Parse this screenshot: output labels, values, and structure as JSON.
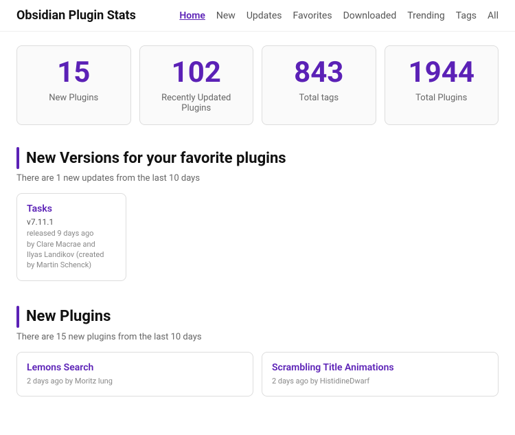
{
  "header": {
    "site_title": "Obsidian Plugin Stats",
    "nav": [
      {
        "label": "Home",
        "active": true
      },
      {
        "label": "New",
        "active": false
      },
      {
        "label": "Updates",
        "active": false
      },
      {
        "label": "Favorites",
        "active": false
      },
      {
        "label": "Downloaded",
        "active": false
      },
      {
        "label": "Trending",
        "active": false
      },
      {
        "label": "Tags",
        "active": false
      },
      {
        "label": "All",
        "active": false
      }
    ]
  },
  "stats": [
    {
      "number": "15",
      "label": "New Plugins"
    },
    {
      "number": "102",
      "label": "Recently Updated Plugins"
    },
    {
      "number": "843",
      "label": "Total tags"
    },
    {
      "number": "1944",
      "label": "Total Plugins"
    }
  ],
  "updates_section": {
    "title": "New Versions for your favorite plugins",
    "subtitle": "There are 1 new updates from the last 10 days",
    "plugins": [
      {
        "name": "Tasks",
        "version": "v7.11.1",
        "meta": "released 9 days ago\nby Clare Macrae and\nIlyas Landikov (created\nby Martin Schenck)"
      }
    ]
  },
  "new_plugins_section": {
    "title": "New Plugins",
    "subtitle": "There are 15 new plugins from the last 10 days",
    "plugins": [
      {
        "name": "Lemons Search",
        "meta": "2 days ago by Moritz lung"
      },
      {
        "name": "Scrambling Title Animations",
        "meta": "2 days ago by HistidineDwarf"
      }
    ]
  }
}
